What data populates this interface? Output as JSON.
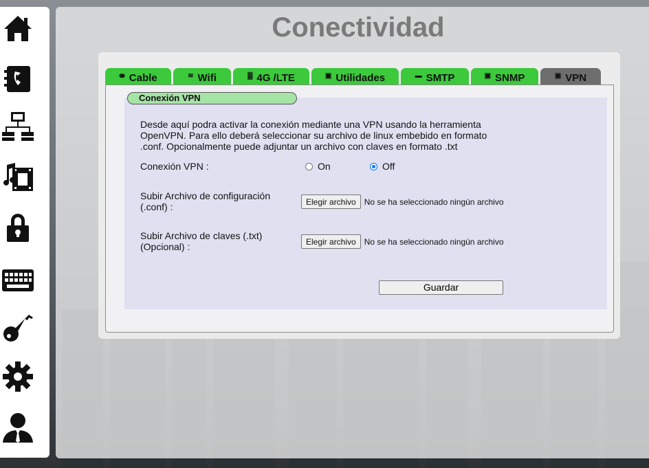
{
  "page": {
    "title": "Conectividad"
  },
  "sidebar": {
    "items": [
      {
        "icon": "home-icon"
      },
      {
        "icon": "phonebook-icon"
      },
      {
        "icon": "network-icon"
      },
      {
        "icon": "media-icon"
      },
      {
        "icon": "lock-icon"
      },
      {
        "icon": "keyboard-icon"
      },
      {
        "icon": "key-icon"
      },
      {
        "icon": "gear-icon"
      },
      {
        "icon": "user-icon"
      }
    ]
  },
  "tabs": [
    {
      "label": "Cable",
      "icon": "ethernet-icon"
    },
    {
      "label": "Wifi",
      "icon": "wifi-icon"
    },
    {
      "label": "4G /LTE",
      "icon": "signal-icon"
    },
    {
      "label": "Utilidades",
      "icon": "tools-icon"
    },
    {
      "label": "SMTP",
      "icon": "mail-icon"
    },
    {
      "label": "SNMP",
      "icon": "document-icon"
    },
    {
      "label": "VPN",
      "icon": "document-icon",
      "active": true
    }
  ],
  "vpn": {
    "section_label": "Conexión VPN",
    "description": "Desde aquí podra activar la conexión mediante una VPN usando la herramienta OpenVPN. Para ello deberá seleccionar su archivo de linux embebido en formato .conf. Opcionalmente puede adjuntar un archivo con claves en formato .txt",
    "connection_label": "Conexión VPN :",
    "radio_on": "On",
    "radio_off": "Off",
    "selected": "Off",
    "config_label_1": "Subir Archivo de configuración",
    "config_label_2": "(.conf) :",
    "keys_label_1": "Subir Archivo de claves (.txt)",
    "keys_label_2": "(Opcional) :",
    "file_button": "Elegir archivo",
    "no_file_text": "No se ha seleccionado ningún archivo",
    "save_label": "Guardar"
  },
  "colors": {
    "tab_green": "#3cc93c",
    "tab_active": "#6e6e6e",
    "section_label_bg": "#a6e3a6",
    "title": "#7a7a7a"
  }
}
